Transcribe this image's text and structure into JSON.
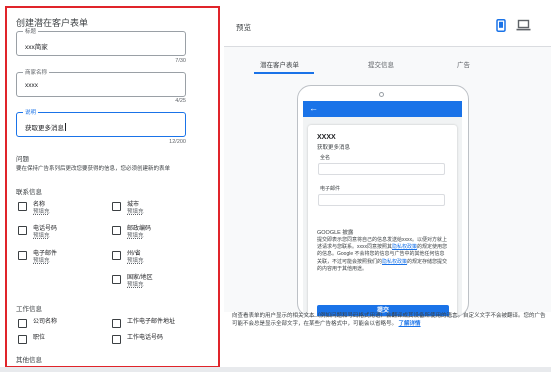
{
  "form": {
    "title": "创建潜在客户表单",
    "headline_field": {
      "label": "标题",
      "value": "xxx简家",
      "counter": "7/30"
    },
    "business_field": {
      "label": "商家名称",
      "value": "xxxx",
      "counter": "4/25"
    },
    "description_field": {
      "label": "说明",
      "value": "获取更多消息",
      "counter": "12/200"
    },
    "questions": {
      "title": "问题",
      "desc": "要在保持广告系列后更改您要获得的信息，您必须创建新的表单"
    },
    "contact": {
      "title": "联系信息",
      "items": [
        {
          "label": "名称",
          "sub": "预填充"
        },
        {
          "label": "城市",
          "sub": "预填充"
        },
        {
          "label": "电话号码",
          "sub": "预填充"
        },
        {
          "label": "邮政编码",
          "sub": "预填充"
        },
        {
          "label": "电子邮件",
          "sub": "预填充"
        },
        {
          "label": "州/省",
          "sub": "预填充"
        },
        {
          "label": "国家/地区",
          "sub": "预填充"
        }
      ]
    },
    "work": {
      "title": "工作信息",
      "items": [
        {
          "label": "公司名称"
        },
        {
          "label": "工作电子邮件地址"
        },
        {
          "label": "职位"
        },
        {
          "label": "工作电话号码"
        }
      ]
    },
    "other_title": "其他信息"
  },
  "preview": {
    "title": "预览",
    "tabs": [
      "潜在客户表单",
      "提交信息",
      "广告"
    ],
    "card": {
      "brand": "XXXX",
      "headline": "获取更多消息",
      "field_1": "全名",
      "field_2": "电子邮件",
      "privacy_title": "GOOGLE 披露",
      "privacy_pre": "提交即表示您同意将自己的信息发送给xxxx。以便对方就上述请求与您联系。xxxx同意按照其",
      "privacy_link_1": "隐私权政策",
      "privacy_mid": "的规定使用您的信息。Google 不会将您的信息与广告中的其他任何信息关联，不过可能会按照我们的",
      "privacy_link_2": "隐私权政策",
      "privacy_post": "的规定存储您提交的内容用于其他用途。",
      "submit": "提交"
    },
    "footer_text": "向查看表单的用户显示的相关文本（例如问题和号码格式用语）会翻译成其设备所使用的语言。自定义文字不会被翻译。您的广告可能不会总是显示全部文字，在某些广告格式中，可能会以省略号。",
    "footer_link": "了解详情"
  },
  "colors": {
    "accent": "#1a73e8",
    "highlight": "#e0242a"
  },
  "icons": [
    "smartphone-icon",
    "laptop-icon",
    "back-arrow-icon"
  ]
}
